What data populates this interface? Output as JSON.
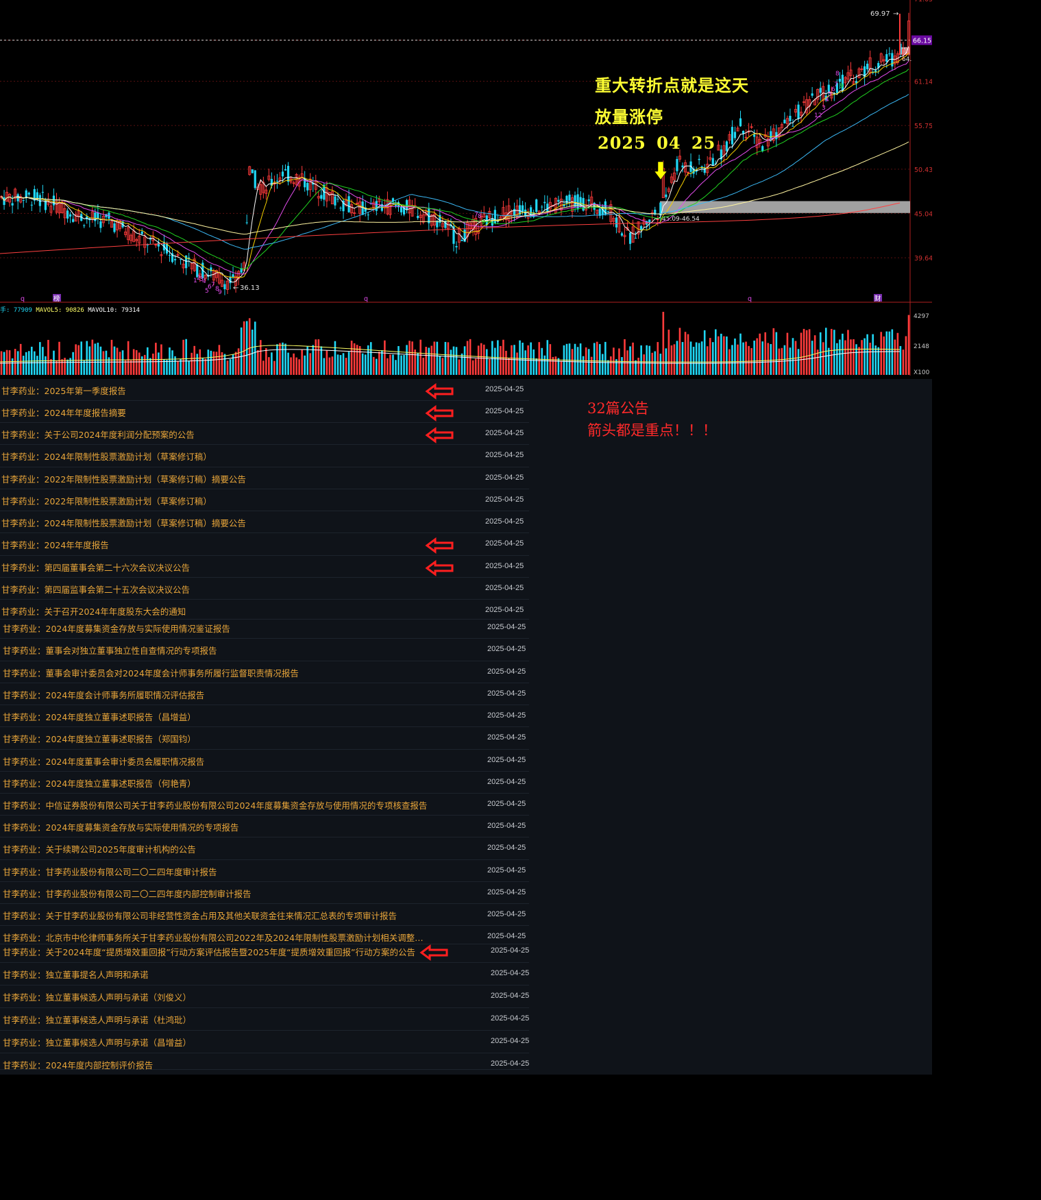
{
  "chart_data": {
    "type": "candlestick",
    "y_ticks": [
      "66.15",
      "61.14",
      "55.75",
      "50.43",
      "45.04",
      "39.64"
    ],
    "top_tick_partial": "71.05",
    "current_price_label": "66.15",
    "low_price_label": "64.",
    "high_marker_label": "69.97",
    "low_marker_label": "36.13",
    "zone_label": "45.09-46.54",
    "bottom_markers": [
      "q",
      "榜",
      "q",
      "q",
      "财"
    ],
    "seq_low_digits": [
      "1",
      "2",
      "3",
      "4",
      "5",
      "6",
      "7",
      "8",
      "9"
    ],
    "seq_mid_digits": [
      "7",
      "8",
      "9"
    ],
    "seq_high_digits": [
      "12",
      "3",
      "4",
      "5",
      "6",
      "7",
      "8",
      "9"
    ],
    "volume": {
      "legend": [
        "手: 77909",
        "MAVOL5: 90826",
        "MAVOL10: 79314"
      ],
      "ticks": [
        "4297",
        "2148",
        "X100"
      ]
    },
    "colors": {
      "up": "#ff3b3b",
      "down": "#20d7f5",
      "ma5": "#ffffff",
      "ma10": "#f7d000",
      "ma20": "#e34dee",
      "ma30": "#21d421",
      "ma60": "#3bb8f5",
      "ma120": "#fff4a0",
      "ma250": "#ff4040"
    }
  },
  "annotations": {
    "title": "重大转折点就是这天",
    "subtitle": "放量涨停",
    "date": "2025 04 25",
    "note_count": "32篇公告",
    "note_arrow": "箭头都是重点！！！"
  },
  "announcements": [
    {
      "title": "甘李药业：2025年第一季度报告",
      "date": "2025-04-25",
      "arrow": true
    },
    {
      "title": "甘李药业：2024年年度报告摘要",
      "date": "2025-04-25",
      "arrow": true
    },
    {
      "title": "甘李药业：关于公司2024年度利润分配预案的公告",
      "date": "2025-04-25",
      "arrow": true
    },
    {
      "title": "甘李药业：2024年限制性股票激励计划（草案修订稿）",
      "date": "2025-04-25",
      "arrow": false
    },
    {
      "title": "甘李药业：2022年限制性股票激励计划（草案修订稿）摘要公告",
      "date": "2025-04-25",
      "arrow": false
    },
    {
      "title": "甘李药业：2022年限制性股票激励计划（草案修订稿）",
      "date": "2025-04-25",
      "arrow": false
    },
    {
      "title": "甘李药业：2024年限制性股票激励计划（草案修订稿）摘要公告",
      "date": "2025-04-25",
      "arrow": false
    },
    {
      "title": "甘李药业：2024年年度报告",
      "date": "2025-04-25",
      "arrow": true
    },
    {
      "title": "甘李药业：第四届董事会第二十六次会议决议公告",
      "date": "2025-04-25",
      "arrow": true
    },
    {
      "title": "甘李药业：第四届监事会第二十五次会议决议公告",
      "date": "2025-04-25",
      "arrow": false
    },
    {
      "title": "甘李药业：关于召开2024年年度股东大会的通知",
      "date": "2025-04-25",
      "arrow": false
    },
    {
      "title": "甘李药业：2024年度募集资金存放与实际使用情况鉴证报告",
      "date": "2025-04-25",
      "arrow": false
    },
    {
      "title": "甘李药业：董事会对独立董事独立性自查情况的专项报告",
      "date": "2025-04-25",
      "arrow": false
    },
    {
      "title": "甘李药业：董事会审计委员会对2024年度会计师事务所履行监督职责情况报告",
      "date": "2025-04-25",
      "arrow": false
    },
    {
      "title": "甘李药业：2024年度会计师事务所履职情况评估报告",
      "date": "2025-04-25",
      "arrow": false
    },
    {
      "title": "甘李药业：2024年度独立董事述职报告（昌增益）",
      "date": "2025-04-25",
      "arrow": false
    },
    {
      "title": "甘李药业：2024年度独立董事述职报告（郑国钧）",
      "date": "2025-04-25",
      "arrow": false
    },
    {
      "title": "甘李药业：2024年度董事会审计委员会履职情况报告",
      "date": "2025-04-25",
      "arrow": false
    },
    {
      "title": "甘李药业：2024年度独立董事述职报告（何艳青）",
      "date": "2025-04-25",
      "arrow": false
    },
    {
      "title": "甘李药业：中信证券股份有限公司关于甘李药业股份有限公司2024年度募集资金存放与使用情况的专项核查报告",
      "date": "2025-04-25",
      "arrow": false
    },
    {
      "title": "甘李药业：2024年度募集资金存放与实际使用情况的专项报告",
      "date": "2025-04-25",
      "arrow": false
    },
    {
      "title": "甘李药业：关于续聘公司2025年度审计机构的公告",
      "date": "2025-04-25",
      "arrow": false
    },
    {
      "title": "甘李药业：甘李药业股份有限公司二〇二四年度审计报告",
      "date": "2025-04-25",
      "arrow": false
    },
    {
      "title": "甘李药业：甘李药业股份有限公司二〇二四年度内部控制审计报告",
      "date": "2025-04-25",
      "arrow": false
    },
    {
      "title": "甘李药业：关于甘李药业股份有限公司非经营性资金占用及其他关联资金往来情况汇总表的专项审计报告",
      "date": "2025-04-25",
      "arrow": false
    },
    {
      "title": "甘李药业：北京市中伦律师事务所关于甘李药业股份有限公司2022年及2024年限制性股票激励计划相关调整事...",
      "date": "2025-04-25",
      "arrow": false
    },
    {
      "title": "甘李药业：关于2024年度“提质增效重回报”行动方案评估报告暨2025年度“提质增效重回报”行动方案的公告",
      "date": "2025-04-25",
      "arrow": true
    },
    {
      "title": "甘李药业：独立董事提名人声明和承诺",
      "date": "2025-04-25",
      "arrow": false
    },
    {
      "title": "甘李药业：独立董事候选人声明与承诺（刘俊义）",
      "date": "2025-04-25",
      "arrow": false
    },
    {
      "title": "甘李药业：独立董事候选人声明与承诺（杜鸿玭）",
      "date": "2025-04-25",
      "arrow": false
    },
    {
      "title": "甘李药业：独立董事候选人声明与承诺（昌增益）",
      "date": "2025-04-25",
      "arrow": false
    },
    {
      "title": "甘李药业：2024年度内部控制评价报告",
      "date": "2025-04-25",
      "arrow": false
    }
  ]
}
